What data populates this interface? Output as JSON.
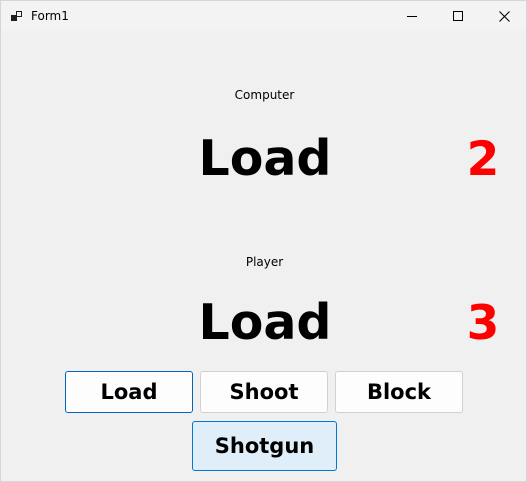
{
  "window": {
    "title": "Form1"
  },
  "computer": {
    "label": "Computer",
    "move": "Load",
    "score": "2"
  },
  "player": {
    "label": "Player",
    "move": "Load",
    "score": "3"
  },
  "buttons": {
    "load": "Load",
    "shoot": "Shoot",
    "block": "Block",
    "shotgun": "Shotgun"
  },
  "colors": {
    "score": "#ff0000",
    "focus_border": "#0067c0",
    "hover_fill": "#e0eef9"
  },
  "icons": {
    "app": "form-app-icon",
    "minimize": "minimize-icon",
    "maximize": "maximize-icon",
    "close": "close-icon"
  }
}
